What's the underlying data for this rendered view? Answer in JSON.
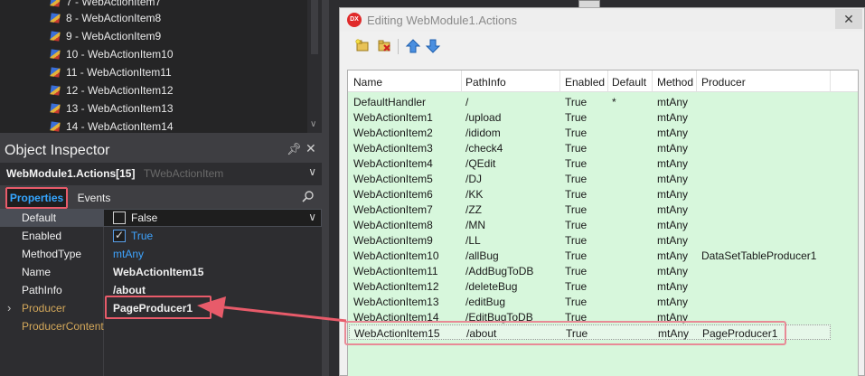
{
  "tree": {
    "items": [
      {
        "label": "7 - WebActionItem7"
      },
      {
        "label": "8 - WebActionItem8"
      },
      {
        "label": "9 - WebActionItem9"
      },
      {
        "label": "10 - WebActionItem10"
      },
      {
        "label": "11 - WebActionItem11"
      },
      {
        "label": "12 - WebActionItem12"
      },
      {
        "label": "13 - WebActionItem13"
      },
      {
        "label": "14 - WebActionItem14"
      }
    ]
  },
  "object_inspector": {
    "title": "Object Inspector",
    "selected_object": "WebModule1.Actions[15]",
    "selected_class": "TWebActionItem",
    "tabs": [
      "Properties",
      "Events"
    ],
    "properties": [
      {
        "name": "Default",
        "value": "False"
      },
      {
        "name": "Enabled",
        "value": "True"
      },
      {
        "name": "MethodType",
        "value": "mtAny"
      },
      {
        "name": "Name",
        "value": "WebActionItem15"
      },
      {
        "name": "PathInfo",
        "value": "/about"
      },
      {
        "name": "Producer",
        "value": "PageProducer1"
      },
      {
        "name": "ProducerContent",
        "value": ""
      }
    ]
  },
  "dialog": {
    "icon_text": "DX",
    "title": "Editing WebModule1.Actions",
    "close_label": "✕",
    "columns": [
      "Name",
      "PathInfo",
      "Enabled",
      "Default",
      "Method",
      "Producer"
    ],
    "rows": [
      [
        "DefaultHandler",
        "/",
        "True",
        "*",
        "mtAny",
        ""
      ],
      [
        "WebActionItem1",
        "/upload",
        "True",
        "",
        "mtAny",
        ""
      ],
      [
        "WebActionItem2",
        "/ididom",
        "True",
        "",
        "mtAny",
        ""
      ],
      [
        "WebActionItem3",
        "/check4",
        "True",
        "",
        "mtAny",
        ""
      ],
      [
        "WebActionItem4",
        "/QEdit",
        "True",
        "",
        "mtAny",
        ""
      ],
      [
        "WebActionItem5",
        "/DJ",
        "True",
        "",
        "mtAny",
        ""
      ],
      [
        "WebActionItem6",
        "/KK",
        "True",
        "",
        "mtAny",
        ""
      ],
      [
        "WebActionItem7",
        "/ZZ",
        "True",
        "",
        "mtAny",
        ""
      ],
      [
        "WebActionItem8",
        "/MN",
        "True",
        "",
        "mtAny",
        ""
      ],
      [
        "WebActionItem9",
        "/LL",
        "True",
        "",
        "mtAny",
        ""
      ],
      [
        "WebActionItem10",
        "/allBug",
        "True",
        "",
        "mtAny",
        "DataSetTableProducer1"
      ],
      [
        "WebActionItem11",
        "/AddBugToDB",
        "True",
        "",
        "mtAny",
        ""
      ],
      [
        "WebActionItem12",
        "/deleteBug",
        "True",
        "",
        "mtAny",
        ""
      ],
      [
        "WebActionItem13",
        "/editBug",
        "True",
        "",
        "mtAny",
        ""
      ],
      [
        "WebActionItem14",
        "/EditBugToDB",
        "True",
        "",
        "mtAny",
        ""
      ],
      [
        "WebActionItem15",
        "/about",
        "True",
        "",
        "mtAny",
        "PageProducer1"
      ]
    ]
  },
  "colors": {
    "list_background": "#d7f7dc",
    "annotation_red": "#e85b6a",
    "accent_blue": "#3ea4ff"
  }
}
